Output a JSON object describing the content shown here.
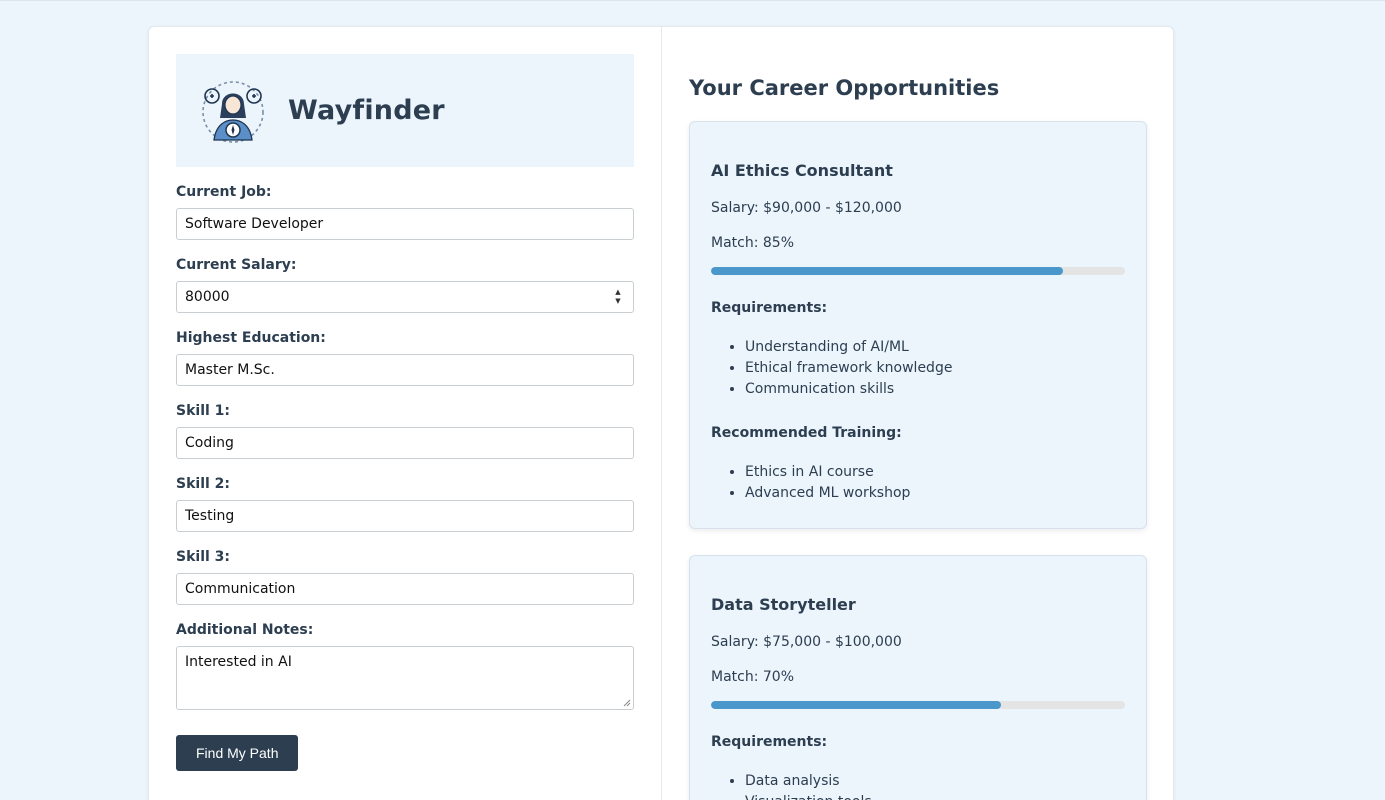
{
  "app": {
    "name": "Wayfinder"
  },
  "form": {
    "current_job_label": "Current Job:",
    "current_job_value": "Software Developer",
    "current_salary_label": "Current Salary:",
    "current_salary_value": "80000",
    "education_label": "Highest Education:",
    "education_value": "Master M.Sc.",
    "skill1_label": "Skill 1:",
    "skill1_value": "Coding",
    "skill2_label": "Skill 2:",
    "skill2_value": "Testing",
    "skill3_label": "Skill 3:",
    "skill3_value": "Communication",
    "notes_label": "Additional Notes:",
    "notes_value": "Interested in AI",
    "submit_label": "Find My Path"
  },
  "results": {
    "heading": "Your Career Opportunities",
    "cards": [
      {
        "title": "AI Ethics Consultant",
        "salary": "Salary: $90,000 - $120,000",
        "match": "Match: 85%",
        "match_percent": 85,
        "requirements_label": "Requirements:",
        "requirements": [
          "Understanding of AI/ML",
          "Ethical framework knowledge",
          "Communication skills"
        ],
        "training_label": "Recommended Training:",
        "training": [
          "Ethics in AI course",
          "Advanced ML workshop"
        ]
      },
      {
        "title": "Data Storyteller",
        "salary": "Salary: $75,000 - $100,000",
        "match": "Match: 70%",
        "match_percent": 70,
        "requirements_label": "Requirements:",
        "requirements": [
          "Data analysis",
          "Visualization tools"
        ]
      }
    ]
  },
  "colors": {
    "primary": "#2c3e50",
    "accent": "#4a97cc",
    "background": "#edf5fc",
    "card": "#ecf4fc"
  }
}
